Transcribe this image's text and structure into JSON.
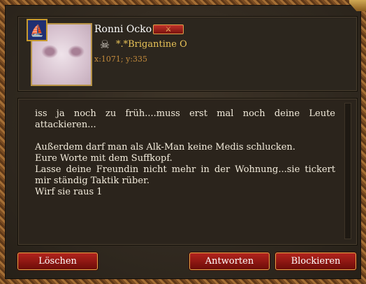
{
  "header": {
    "player_name": "Ronni Ocko",
    "name_action_glyph": "⚔",
    "alliance": "*.*Brigantine O",
    "coordinates": "x:1071; y:335",
    "flag_icon": "ship-flag-icon",
    "rank_icon": "skull-icon"
  },
  "message": {
    "body": "iss ja noch zu früh....muss erst mal noch deine Leute attackieren...\n\nAußerdem darf man als Alk-Man keine Medis schlucken.\nEure Worte mit dem Suffkopf.\nLasse deine Freundin nicht mehr in der Wohnung...sie tickert mir ständig Taktik rüber.\nWirf sie raus 1"
  },
  "buttons": {
    "delete": "Löschen",
    "reply": "Antworten",
    "block": "Blockieren"
  },
  "colors": {
    "accent_gold": "#e8c257",
    "button_red": "#b3241d",
    "coords_orange": "#c28a3c"
  }
}
